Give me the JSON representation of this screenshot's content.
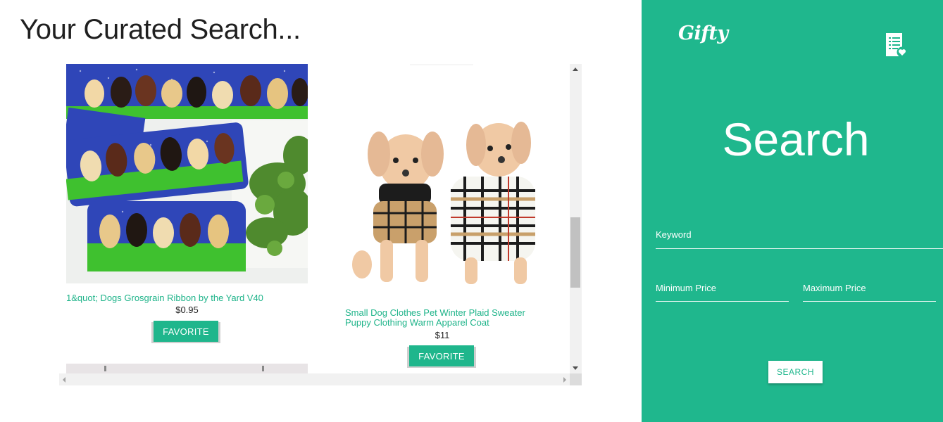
{
  "page": {
    "title": "Your Curated Search..."
  },
  "results": [
    {
      "name": "1&quot; Dogs Grosgrain Ribbon by the Yard V40",
      "price": "$0.95",
      "button": "FAVORITE"
    },
    {
      "name": "Small Dog Clothes Pet Winter Plaid Sweater Puppy Clothing Warm Apparel Coat",
      "price": "$11",
      "button": "FAVORITE"
    }
  ],
  "sidebar": {
    "logo": "Gifty",
    "heading": "Search",
    "keyword_label": "Keyword",
    "keyword_value": "",
    "min_price_label": "Minimum Price",
    "min_price_value": "",
    "max_price_label": "Maximum Price",
    "max_price_value": "",
    "search_button": "SEARCH",
    "icon": "wishlist-icon"
  },
  "colors": {
    "accent": "#1fb78d",
    "link": "#1fb48a",
    "text": "#1f1f1f"
  }
}
